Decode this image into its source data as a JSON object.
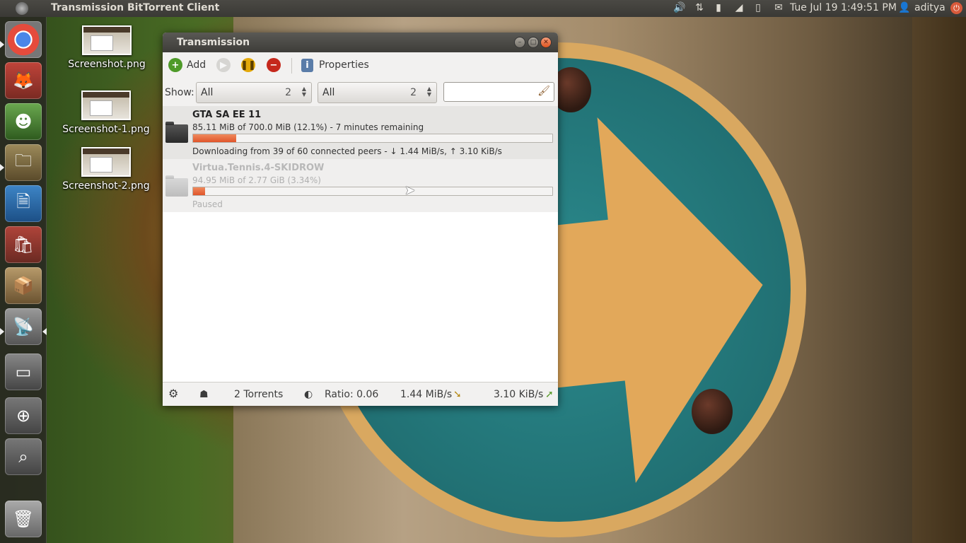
{
  "top_panel": {
    "app_title": "Transmission BitTorrent Client",
    "clock": "Tue Jul 19  1:49:51 PM",
    "user": "aditya",
    "indicators": [
      "sound-icon",
      "network-icon",
      "battery-icon",
      "signal-icon",
      "power-adapter-icon",
      "mail-icon"
    ]
  },
  "desktop": {
    "icons": [
      {
        "label": "Screenshot.png"
      },
      {
        "label": "Screenshot-1.png"
      },
      {
        "label": "Screenshot-2.png"
      }
    ]
  },
  "window": {
    "title": "Transmission",
    "toolbar": {
      "add_label": "Add",
      "properties_label": "Properties"
    },
    "filter": {
      "show_label": "Show:",
      "activity": {
        "value": "All",
        "count": "2"
      },
      "tracker": {
        "value": "All",
        "count": "2"
      },
      "search_value": ""
    },
    "torrents": [
      {
        "name": "GTA SA EE 11",
        "progress_text": "85.11 MiB of 700.0 MiB (12.1%) - 7 minutes remaining",
        "progress_fraction": 0.121,
        "status": "Downloading from 39 of 60 connected peers - ↓ 1.44 MiB/s, ↑ 3.10 KiB/s"
      },
      {
        "name": "Virtua.Tennis.4-SKIDROW",
        "progress_text": "94.95 MiB of 2.77 GiB (3.34%)",
        "progress_fraction": 0.0334,
        "status": "Paused"
      }
    ],
    "statusbar": {
      "torrent_count": "2 Torrents",
      "ratio": "Ratio: 0.06",
      "down_speed": "1.44 MiB/s",
      "up_speed": "3.10 KiB/s"
    }
  },
  "colors": {
    "progress": "#e0552a",
    "panel": "#3c3b37"
  }
}
